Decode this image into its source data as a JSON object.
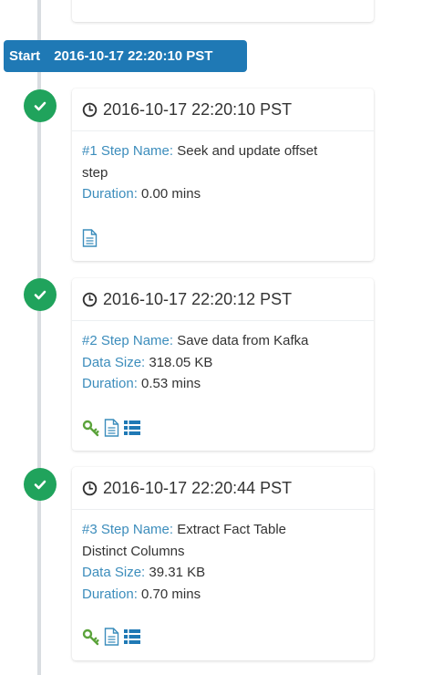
{
  "start": {
    "label": "Start",
    "timestamp": "2016-10-17 22:20:10 PST"
  },
  "steps": [
    {
      "timestamp": "2016-10-17 22:20:10 PST",
      "step_label": "#1 Step Name:",
      "step_name_line1": "Seek and update offset",
      "step_name_line2": "step",
      "duration_label": "Duration:",
      "duration": "0.00 mins",
      "icons": [
        "log-file-icon"
      ]
    },
    {
      "timestamp": "2016-10-17 22:20:12 PST",
      "step_label": "#2 Step Name:",
      "step_name_line1": "Save data from Kafka",
      "data_size_label": "Data Size:",
      "data_size": "318.05 KB",
      "duration_label": "Duration:",
      "duration": "0.53 mins",
      "icons": [
        "key-icon",
        "log-file-icon",
        "list-icon"
      ]
    },
    {
      "timestamp": "2016-10-17 22:20:44 PST",
      "step_label": "#3 Step Name:",
      "step_name_line1": "Extract Fact Table",
      "step_name_line2": "Distinct Columns",
      "data_size_label": "Data Size:",
      "data_size": "39.31 KB",
      "duration_label": "Duration:",
      "duration": "0.70 mins",
      "icons": [
        "key-icon",
        "log-file-icon",
        "list-icon"
      ]
    }
  ],
  "colors": {
    "accent": "#3c8dbc",
    "success": "#20a35c",
    "start_bar": "#1f79b5",
    "key": "#5ba33b",
    "timeline": "#d9dde1"
  }
}
